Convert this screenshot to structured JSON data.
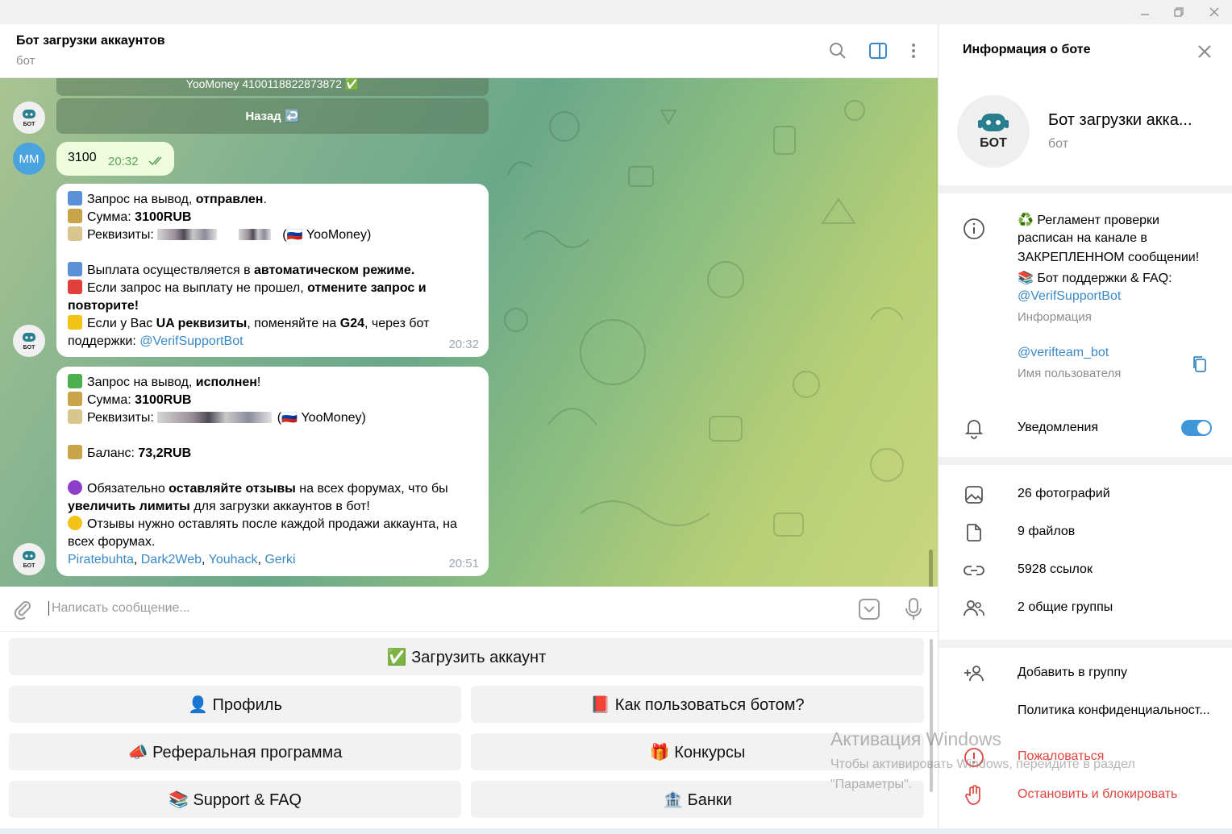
{
  "header": {
    "title": "Бот загрузки аккаунтов",
    "subtitle": "бот"
  },
  "chat": {
    "partial_top_text": "YooMoney 4100118822873872 ✅",
    "back_button": "Назад ↩️",
    "outgoing": {
      "avatar_initials": "MM",
      "text": "3100",
      "time": "20:32"
    },
    "msg1": {
      "l1a": "Запрос на вывод, ",
      "l1b": "отправлен",
      "l1c": ".",
      "l2a": "Сумма: ",
      "l2b": "3100RUB",
      "l3a": "Реквизиты:",
      "l3b": "(🇷🇺 YooMoney)",
      "l4a": "Выплата осуществляется в ",
      "l4b": "автоматическом режиме.",
      "l5a": "Если запрос на выплату не прошел, ",
      "l5b": "отмените запрос и",
      "l6": "повторите!",
      "l7a": "Если у Вас ",
      "l7b": "UA реквизиты",
      "l7c": ", поменяйте на ",
      "l7d": "G24",
      "l7e": ", через бот",
      "l8a": "поддержки: ",
      "l8b": "@VerifSupportBot",
      "time": "20:32"
    },
    "msg2": {
      "l1a": "Запрос на вывод, ",
      "l1b": "исполнен",
      "l1c": "!",
      "l2a": "Сумма: ",
      "l2b": "3100RUB",
      "l3a": "Реквизиты:",
      "l3b": "(🇷🇺 YooMoney)",
      "l4a": "Баланс: ",
      "l4b": "73,2RUB",
      "l5a": "Обязательно ",
      "l5b": "оставляйте отзывы",
      "l5c": " на всех форумах, что бы",
      "l6a": "увеличить лимиты",
      "l6b": " для загрузки аккаунтов в бот!",
      "l7": "Отзывы нужно оставлять после каждой продажи аккаунта, на",
      "l8": "всех форумах.",
      "links": [
        "Piratebuhta",
        "Dark2Web",
        "Youhack",
        "Gerki"
      ],
      "sep": ", ",
      "time": "20:51"
    },
    "bot_avatar_label": "БОТ"
  },
  "composer": {
    "placeholder": "Написать сообщение..."
  },
  "keyboard": {
    "upload": "✅ Загрузить аккаунт",
    "profile": "👤 Профиль",
    "howto": "📕 Как пользоваться ботом?",
    "referral": "📣 Реферальная программа",
    "contests": "🎁 Конкурсы",
    "support": "📚 Support & FAQ",
    "banks": "🏦 Банки"
  },
  "panel": {
    "title": "Информация о боте",
    "name": "Бот загрузки акка...",
    "sub": "бот",
    "avatar_label": "БОТ",
    "info_l1": "♻️ Регламент проверки",
    "info_l2": "расписан на канале в",
    "info_l3": "ЗАКРЕПЛЕННОМ сообщении!",
    "info_l4": "📚 Бот поддержки & FAQ:",
    "info_link": "@VerifSupportBot",
    "info_label": "Информация",
    "username": "@verifteam_bot",
    "username_label": "Имя пользователя",
    "notifications": "Уведомления",
    "photos": "26 фотографий",
    "files": "9 файлов",
    "links": "5928 ссылок",
    "groups": "2 общие группы",
    "add_group": "Добавить в группу",
    "privacy": "Политика конфиденциальност...",
    "report": "Пожаловаться",
    "block": "Остановить и блокировать"
  },
  "watermark": {
    "line1": "Активация Windows",
    "line2": "Чтобы активировать Windows, перейдите в раздел",
    "line3": "\"Параметры\"."
  },
  "colors": {
    "accent": "#3a88c5",
    "danger": "#e0443e",
    "outgoing_bubble": "#effdde"
  }
}
